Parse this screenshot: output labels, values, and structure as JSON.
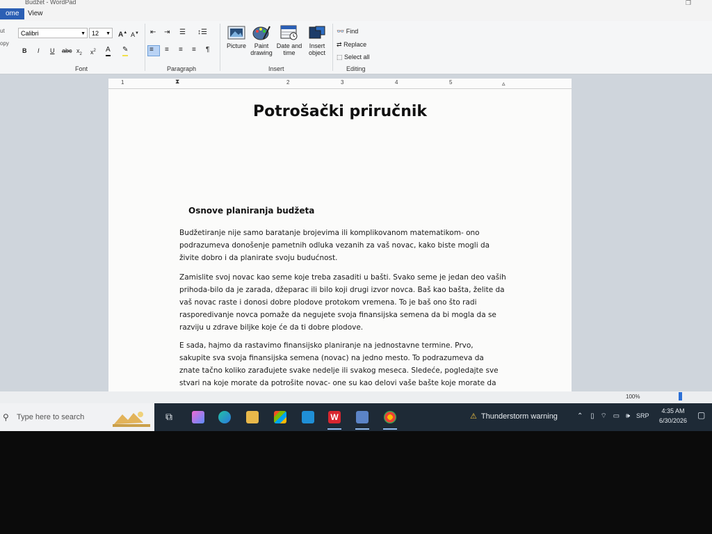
{
  "window": {
    "title": "Budžet - WordPad"
  },
  "ribbon": {
    "tabs": [
      {
        "label": "ome"
      },
      {
        "label": "View"
      }
    ],
    "clipboard": {
      "cut": "ut",
      "copy": "opy"
    },
    "font": {
      "family": "Calibri",
      "size": "12",
      "group_label": "Font"
    },
    "paragraph": {
      "group_label": "Paragraph"
    },
    "insert": {
      "group_label": "Insert",
      "picture": "Picture",
      "paint_line1": "Paint",
      "paint_line2": "drawing",
      "date_line1": "Date and",
      "date_line2": "time",
      "object_line1": "Insert",
      "object_line2": "object"
    },
    "editing": {
      "group_label": "Editing",
      "find": "Find",
      "replace": "Replace",
      "select_all": "Select all"
    }
  },
  "ruler": {
    "numbers": [
      "1",
      "2",
      "3",
      "4",
      "5"
    ]
  },
  "document": {
    "title": "Potrošački priručnik",
    "heading": "Osnove planiranja budžeta",
    "paragraphs": [
      "Budžetiranje nije samo baratanje brojevima ili komplikovanom matematikom- ono podrazumeva donošenje pametnih odluka vezanih za vaš novac, kako biste mogli da živite dobro i da planirate svoju budućnost.",
      "Zamislite svoj novac kao seme koje treba zasaditi u bašti. Svako seme je jedan deo vaših prihoda-bilo da je zarada, džeparac ili bilo koji drugi izvor novca. Baš kao bašta, želite da vaš novac raste i donosi dobre plodove protokom vremena. To je baš ono što radi rasporedivanje novca pomaže da negujete svoja finansijska semena da bi mogla da se razviju u zdrave biljke koje će da ti dobre plodove.",
      "E sada, hajmo da rastavimo finansijsko planiranje na jednostavne termine. Prvo, sakupite sva svoja finansijska semena (novac) na jedno mesto. To podrazumeva da znate tačno koliko zarađujete svake nedelje ili svakog meseca. Sledeće, pogledajte sve stvari na koje morate da potrošite novac- one su kao delovi vaše bašte koje morate da"
    ]
  },
  "statusbar": {
    "zoom": "100%"
  },
  "taskbar": {
    "search_placeholder": "Type here to search",
    "weather": "Thunderstorm warning",
    "language": "SRP",
    "time": "4:35 AM",
    "date": "6/30/2026"
  },
  "colors": {
    "ribbon_accent": "#2b5fb4",
    "taskbar": "#1e2a36",
    "warning": "#f5c542"
  }
}
